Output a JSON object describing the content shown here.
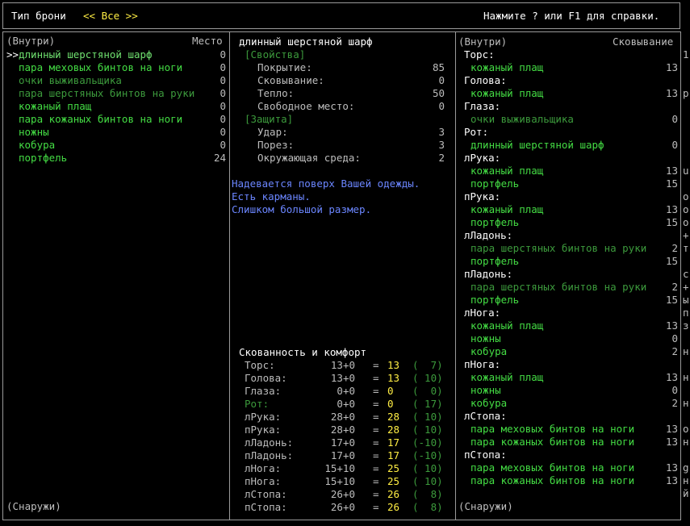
{
  "header": {
    "title": "Тип брони",
    "filter": "<< Все >>",
    "help": "Нажмите ? или F1 для справки."
  },
  "left": {
    "header_label": "(Внутри)",
    "header_col": "Место",
    "cursor": ">>",
    "items": [
      {
        "name": "длинный шерстяной шарф",
        "value": "0",
        "color": "lgreen"
      },
      {
        "name": "пара меховых бинтов на ноги",
        "value": "0",
        "color": "green"
      },
      {
        "name": "очки выживальщика",
        "value": "0",
        "color": "dgreen"
      },
      {
        "name": "пара шерстяных бинтов на руки",
        "value": "0",
        "color": "dgreen"
      },
      {
        "name": "кожаный плащ",
        "value": "0",
        "color": "green"
      },
      {
        "name": "пара кожаных бинтов на ноги",
        "value": "0",
        "color": "green"
      },
      {
        "name": "ножны",
        "value": "0",
        "color": "green"
      },
      {
        "name": "кобура",
        "value": "0",
        "color": "green"
      },
      {
        "name": "портфель",
        "value": "24",
        "color": "green"
      }
    ],
    "footer": "(Снаружи)"
  },
  "middle": {
    "item_title": "длинный шерстяной шарф",
    "props_header": "[Свойства]",
    "props": [
      {
        "label": "Покрытие:",
        "value": "85"
      },
      {
        "label": "Сковывание:",
        "value": "0"
      },
      {
        "label": "Тепло:",
        "value": "50"
      },
      {
        "label": "Свободное место:",
        "value": "0"
      }
    ],
    "prot_header": "[Защита]",
    "prot": [
      {
        "label": "Удар:",
        "value": "3"
      },
      {
        "label": "Порез:",
        "value": "3"
      },
      {
        "label": "Окружающая среда:",
        "value": "2"
      }
    ],
    "notes": [
      "Надевается поверх Вашей одежды.",
      "Есть карманы.",
      "Слишком большой размер."
    ],
    "enc_header": "Скованность и комфорт",
    "enc_rows": [
      {
        "part": "Торс:",
        "base": "13+0",
        "eq": "=",
        "total": "13",
        "warm": "(  7)",
        "color": "gray"
      },
      {
        "part": "Голова:",
        "base": "13+0",
        "eq": "=",
        "total": "13",
        "warm": "( 10)",
        "color": "gray"
      },
      {
        "part": "Глаза:",
        "base": "0+0",
        "eq": "=",
        "total": "0",
        "warm": "(  0)",
        "color": "gray"
      },
      {
        "part": "Рот:",
        "base": "0+0",
        "eq": "=",
        "total": "0",
        "warm": "( 17)",
        "color": "dgreen"
      },
      {
        "part": "лРука:",
        "base": "28+0",
        "eq": "=",
        "total": "28",
        "warm": "( 10)",
        "color": "gray"
      },
      {
        "part": "пРука:",
        "base": "28+0",
        "eq": "=",
        "total": "28",
        "warm": "( 10)",
        "color": "gray"
      },
      {
        "part": "лЛадонь:",
        "base": "17+0",
        "eq": "=",
        "total": "17",
        "warm": "(-10)",
        "color": "gray"
      },
      {
        "part": "пЛадонь:",
        "base": "17+0",
        "eq": "=",
        "total": "17",
        "warm": "(-10)",
        "color": "gray"
      },
      {
        "part": "лНога:",
        "base": "15+10",
        "eq": "=",
        "total": "25",
        "warm": "( 10)",
        "color": "gray"
      },
      {
        "part": "пНога:",
        "base": "15+10",
        "eq": "=",
        "total": "25",
        "warm": "( 10)",
        "color": "gray"
      },
      {
        "part": "лСтопа:",
        "base": "26+0",
        "eq": "=",
        "total": "26",
        "warm": "(  8)",
        "color": "gray"
      },
      {
        "part": "пСтопа:",
        "base": "26+0",
        "eq": "=",
        "total": "26",
        "warm": "(  8)",
        "color": "gray"
      }
    ]
  },
  "right": {
    "header_label": "(Внутри)",
    "header_col": "Сковывание",
    "rows": [
      {
        "type": "part",
        "text": "Торс:"
      },
      {
        "type": "item",
        "text": "кожаный плащ",
        "value": "13",
        "color": "green"
      },
      {
        "type": "part",
        "text": "Голова:"
      },
      {
        "type": "item",
        "text": "кожаный плащ",
        "value": "13",
        "color": "green"
      },
      {
        "type": "part",
        "text": "Глаза:"
      },
      {
        "type": "item",
        "text": "очки выживальщика",
        "value": "0",
        "color": "dgreen"
      },
      {
        "type": "part",
        "text": "Рот:"
      },
      {
        "type": "item",
        "text": "длинный шерстяной шарф",
        "value": "0",
        "color": "green"
      },
      {
        "type": "part",
        "text": "лРука:"
      },
      {
        "type": "item",
        "text": "кожаный плащ",
        "value": "13",
        "color": "green"
      },
      {
        "type": "item",
        "text": "портфель",
        "value": "15",
        "color": "green"
      },
      {
        "type": "part",
        "text": "пРука:"
      },
      {
        "type": "item",
        "text": "кожаный плащ",
        "value": "13",
        "color": "green"
      },
      {
        "type": "item",
        "text": "портфель",
        "value": "15",
        "color": "green"
      },
      {
        "type": "part",
        "text": "лЛадонь:"
      },
      {
        "type": "item",
        "text": "пара шерстяных бинтов на руки",
        "value": "2",
        "color": "dgreen"
      },
      {
        "type": "item",
        "text": "портфель",
        "value": "15",
        "color": "green"
      },
      {
        "type": "part",
        "text": "пЛадонь:"
      },
      {
        "type": "item",
        "text": "пара шерстяных бинтов на руки",
        "value": "2",
        "color": "dgreen"
      },
      {
        "type": "item",
        "text": "портфель",
        "value": "15",
        "color": "green"
      },
      {
        "type": "part",
        "text": "лНога:"
      },
      {
        "type": "item",
        "text": "кожаный плащ",
        "value": "13",
        "color": "green"
      },
      {
        "type": "item",
        "text": "ножны",
        "value": "0",
        "color": "green"
      },
      {
        "type": "item",
        "text": "кобура",
        "value": "2",
        "color": "green"
      },
      {
        "type": "part",
        "text": "пНога:"
      },
      {
        "type": "item",
        "text": "кожаный плащ",
        "value": "13",
        "color": "green"
      },
      {
        "type": "item",
        "text": "ножны",
        "value": "0",
        "color": "green"
      },
      {
        "type": "item",
        "text": "кобура",
        "value": "2",
        "color": "green"
      },
      {
        "type": "part",
        "text": "лСтопа:"
      },
      {
        "type": "item",
        "text": "пара меховых бинтов на ноги",
        "value": "13",
        "color": "green"
      },
      {
        "type": "item",
        "text": "пара кожаных бинтов на ноги",
        "value": "13",
        "color": "green"
      },
      {
        "type": "part",
        "text": "пСтопа:"
      },
      {
        "type": "item",
        "text": "пара меховых бинтов на ноги",
        "value": "13",
        "color": "green"
      },
      {
        "type": "item",
        "text": "пара кожаных бинтов на ноги",
        "value": "13",
        "color": "green"
      }
    ],
    "footer": "(Снаружи)",
    "overflow_chars": [
      "",
      "1",
      "",
      "",
      "р",
      "",
      "",
      "",
      "",
      "",
      "u",
      "",
      "о",
      "о",
      "о",
      "+",
      "т",
      "",
      "с",
      "+",
      "ы",
      "п",
      "з",
      "",
      "н",
      "",
      "н",
      "",
      "н",
      "",
      "о",
      "н",
      "",
      "g",
      "н",
      "й"
    ]
  }
}
